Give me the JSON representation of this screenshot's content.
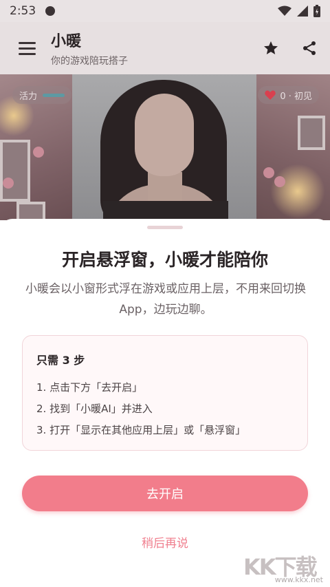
{
  "status_bar": {
    "time": "2:53"
  },
  "app_bar": {
    "title": "小暖",
    "subtitle": "你的游戏陪玩搭子"
  },
  "hero": {
    "vitality_label": "活力",
    "affinity_text": "0 · 初见"
  },
  "sheet": {
    "title": "开启悬浮窗，小暖才能陪你",
    "description": "小暖会以小窗形式浮在游戏或应用上层，不用来回切换 App，边玩边聊。",
    "steps_title": "只需 3 步",
    "steps": [
      "1. 点击下方「去开启」",
      "2. 找到「小暖AI」并进入",
      "3. 打开「显示在其他应用上层」或「悬浮窗」"
    ],
    "primary_button": "去开启",
    "secondary_button": "稍后再说"
  },
  "watermark": {
    "logo": "KK下载",
    "url": "www.kkx.net"
  },
  "colors": {
    "accent": "#f27d8b",
    "card_border": "#f1d4d9",
    "card_bg": "#fff8f9"
  }
}
